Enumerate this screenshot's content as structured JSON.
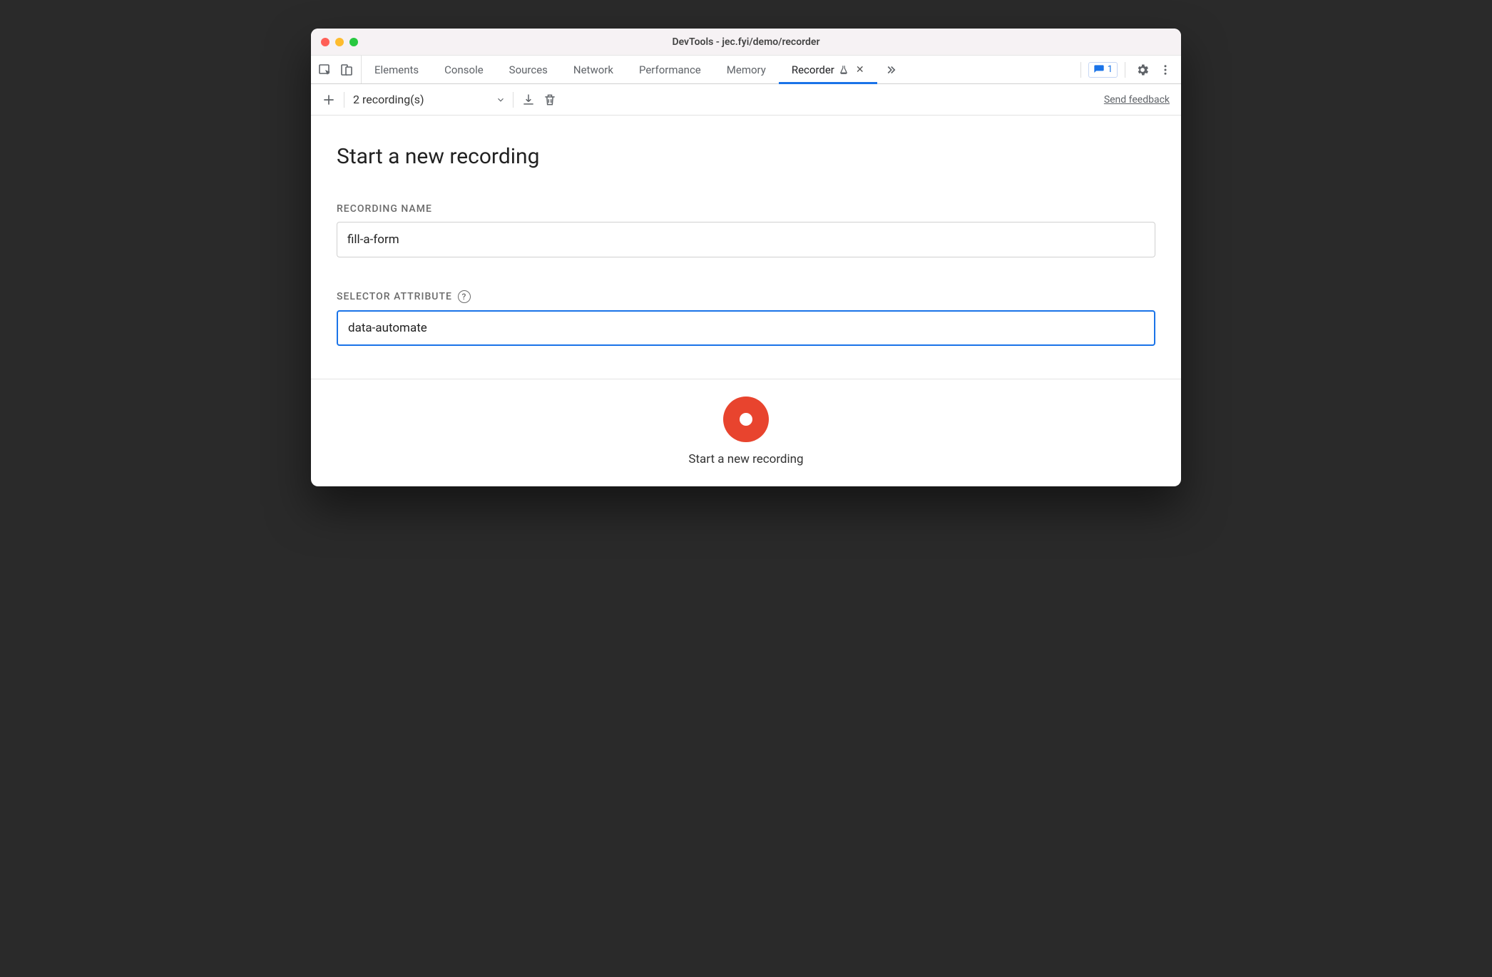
{
  "window": {
    "title": "DevTools - jec.fyi/demo/recorder"
  },
  "tabs": {
    "items": [
      {
        "label": "Elements"
      },
      {
        "label": "Console"
      },
      {
        "label": "Sources"
      },
      {
        "label": "Network"
      },
      {
        "label": "Performance"
      },
      {
        "label": "Memory"
      },
      {
        "label": "Recorder",
        "active": true,
        "experimental": true,
        "closable": true
      }
    ],
    "issues_count": "1"
  },
  "subtoolbar": {
    "recordings_label": "2 recording(s)",
    "feedback_label": "Send feedback"
  },
  "main": {
    "page_title": "Start a new recording",
    "recording_name_label": "RECORDING NAME",
    "recording_name_value": "fill-a-form",
    "selector_attr_label": "SELECTOR ATTRIBUTE",
    "selector_attr_value": "data-automate"
  },
  "footer": {
    "start_label": "Start a new recording"
  }
}
